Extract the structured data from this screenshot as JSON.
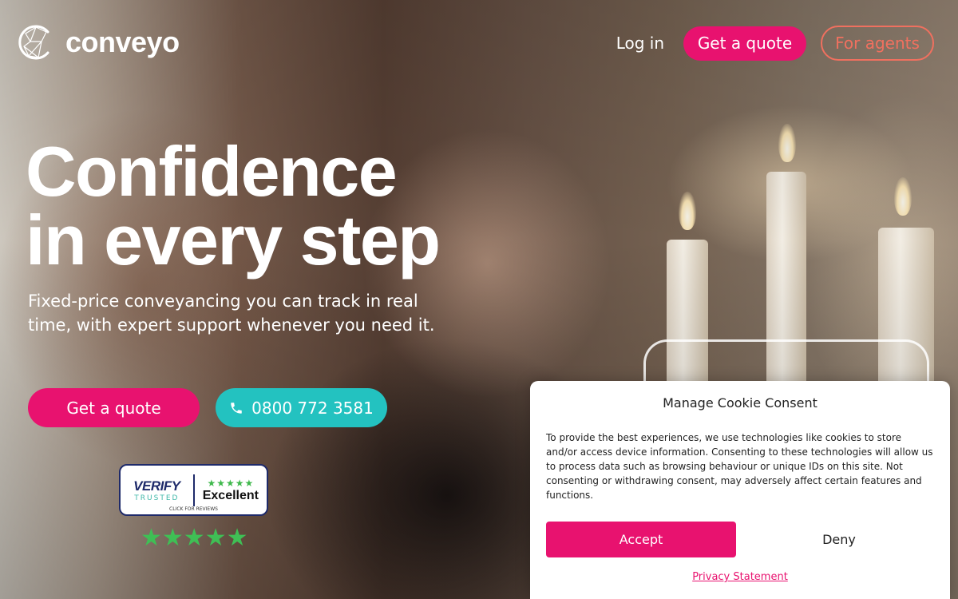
{
  "brand": {
    "name": "conveyo",
    "primary": "#e8126f",
    "accent": "#23c2c0",
    "agent_outline": "#f0705f"
  },
  "nav": {
    "login": "Log in",
    "get_quote": "Get a quote",
    "for_agents": "For agents"
  },
  "hero": {
    "headline_line1": "Confidence",
    "headline_line2": "in every step",
    "subheading": "Fixed-price conveyancing you can track in real time, with expert support whenever you need it.",
    "cta_quote": "Get a quote",
    "cta_phone": "0800 772 3581",
    "phone_icon": "phone-icon"
  },
  "badge": {
    "title": "VERIFY",
    "subtitle": "TRUSTED",
    "stars": "★★★★★",
    "rating": "Excellent",
    "click_text": "CLICK FOR REVIEWS",
    "rating_stars": "★★★★★"
  },
  "cookie": {
    "title": "Manage Cookie Consent",
    "body": "To provide the best experiences, we use technologies like cookies to store and/or access device information. Consenting to these technologies will allow us to process data such as browsing behaviour or unique IDs on this site. Not consenting or withdrawing consent, may adversely affect certain features and functions.",
    "accept": "Accept",
    "deny": "Deny",
    "privacy": "Privacy Statement"
  }
}
